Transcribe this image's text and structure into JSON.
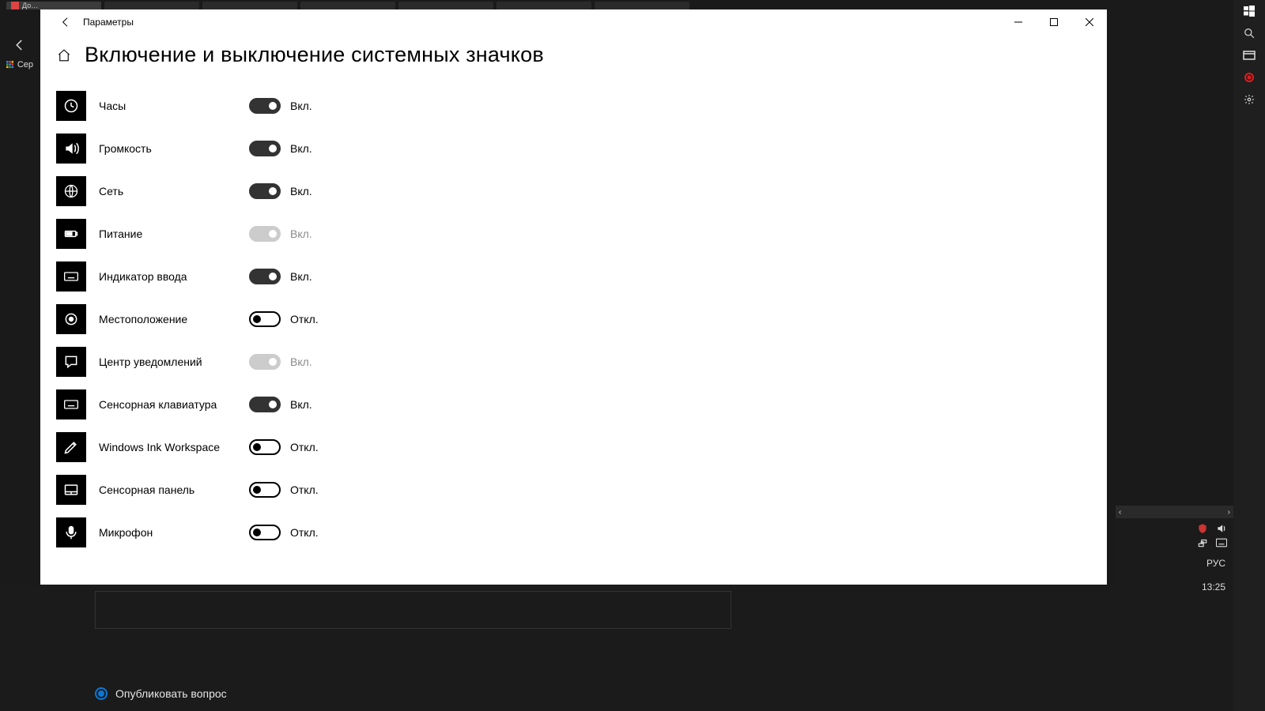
{
  "browser": {
    "tabs": [
      {
        "title": "До…",
        "active": true
      },
      {
        "title": "",
        "active": false
      },
      {
        "title": "",
        "active": false
      },
      {
        "title": "",
        "active": false
      },
      {
        "title": "",
        "active": false
      },
      {
        "title": "",
        "active": false
      },
      {
        "title": "",
        "active": false
      }
    ],
    "apps_label": "Сер"
  },
  "settings": {
    "window_title": "Параметры",
    "page_title": "Включение и выключение системных значков",
    "state_on": "Вкл.",
    "state_off": "Откл.",
    "items": [
      {
        "key": "clock",
        "label": "Часы",
        "on": true,
        "disabled": false
      },
      {
        "key": "volume",
        "label": "Громкость",
        "on": true,
        "disabled": false
      },
      {
        "key": "network",
        "label": "Сеть",
        "on": true,
        "disabled": false
      },
      {
        "key": "power",
        "label": "Питание",
        "on": true,
        "disabled": true
      },
      {
        "key": "input",
        "label": "Индикатор ввода",
        "on": true,
        "disabled": false
      },
      {
        "key": "location",
        "label": "Местоположение",
        "on": false,
        "disabled": false
      },
      {
        "key": "action-center",
        "label": "Центр уведомлений",
        "on": true,
        "disabled": true
      },
      {
        "key": "touch-kbd",
        "label": "Сенсорная клавиатура",
        "on": true,
        "disabled": false
      },
      {
        "key": "ink",
        "label": "Windows Ink Workspace",
        "on": false,
        "disabled": false
      },
      {
        "key": "touchpad",
        "label": "Сенсорная панель",
        "on": false,
        "disabled": false
      },
      {
        "key": "microphone",
        "label": "Микрофон",
        "on": false,
        "disabled": false
      }
    ]
  },
  "lower": {
    "radio_label": "Опубликовать вопрос"
  },
  "tray": {
    "lang": "РУС",
    "time": "13:25"
  }
}
